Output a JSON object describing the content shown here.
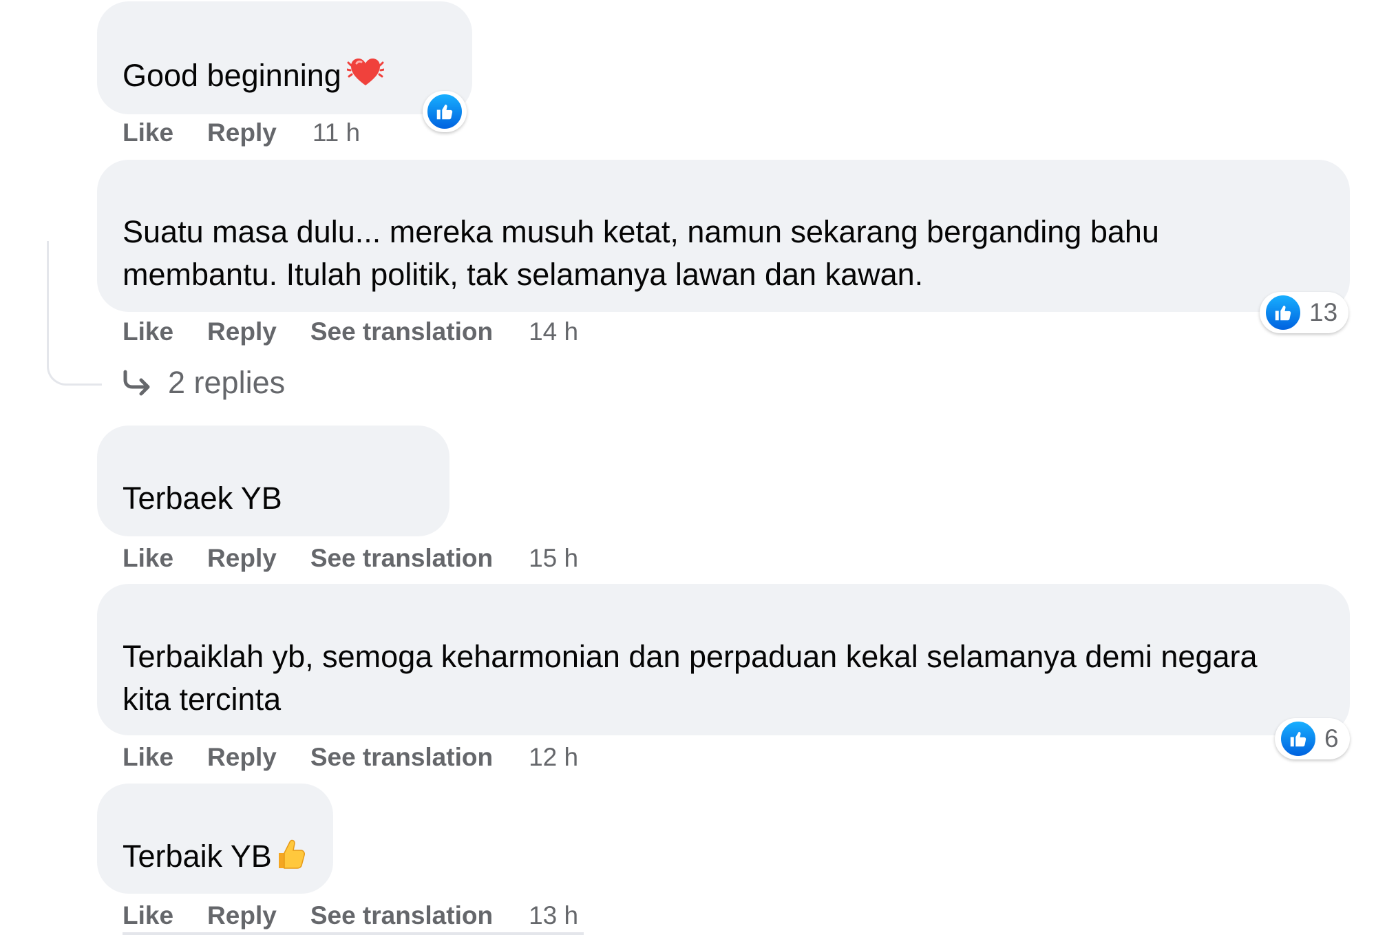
{
  "comments": [
    {
      "text": "Good beginning",
      "emoji": "beating-heart",
      "actions": {
        "like": "Like",
        "reply": "Reply"
      },
      "time": "11 h",
      "reaction": {
        "type": "like",
        "count": ""
      }
    },
    {
      "text": "Suatu masa dulu... mereka musuh ketat, namun sekarang berganding bahu membantu. Itulah politik, tak selamanya lawan dan kawan.",
      "actions": {
        "like": "Like",
        "reply": "Reply",
        "translate": "See translation"
      },
      "time": "14 h",
      "reaction": {
        "type": "like",
        "count": "13"
      },
      "replies": "2 replies"
    },
    {
      "text": "Terbaek YB",
      "actions": {
        "like": "Like",
        "reply": "Reply",
        "translate": "See translation"
      },
      "time": "15 h"
    },
    {
      "text": "Terbaiklah yb, semoga keharmonian dan perpaduan kekal selamanya demi negara kita tercinta",
      "actions": {
        "like": "Like",
        "reply": "Reply",
        "translate": "See translation"
      },
      "time": "12 h",
      "reaction": {
        "type": "like",
        "count": "6"
      }
    },
    {
      "text": "Terbaik YB",
      "emoji": "thumbs-up",
      "actions": {
        "like": "Like",
        "reply": "Reply",
        "translate": "See translation"
      },
      "time": "13 h"
    }
  ],
  "colors": {
    "bubble": "#f0f2f5",
    "text": "#050505",
    "secondary": "#65676b",
    "like_blue": "#0866ff"
  }
}
